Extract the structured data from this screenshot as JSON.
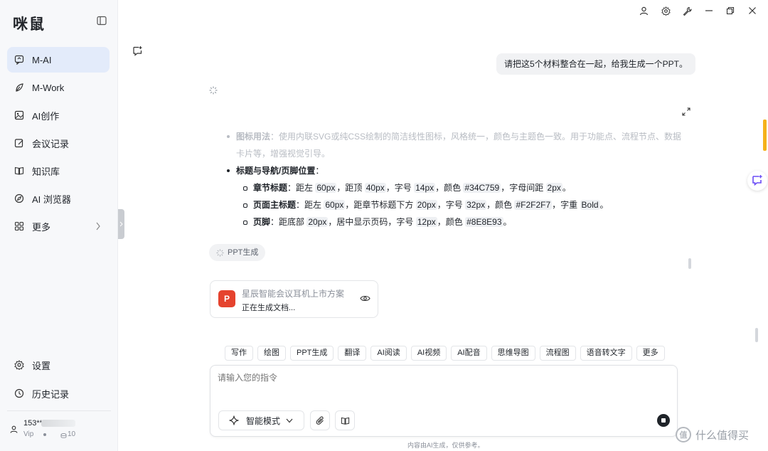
{
  "app": {
    "logo": "咪鼠"
  },
  "sidebar": {
    "items": [
      {
        "label": "M-AI",
        "icon": "chat-ai-icon",
        "active": true
      },
      {
        "label": "M-Work",
        "icon": "leaf-icon"
      },
      {
        "label": "AI创作",
        "icon": "image-icon"
      },
      {
        "label": "会议记录",
        "icon": "edit-note-icon"
      },
      {
        "label": "知识库",
        "icon": "book-icon"
      },
      {
        "label": "AI 浏览器",
        "icon": "compass-icon"
      },
      {
        "label": "更多",
        "icon": "grid-icon"
      }
    ],
    "settings_label": "设置",
    "history_label": "历史记录",
    "user": {
      "phone": "153**",
      "tier": "Vip",
      "points": "10"
    }
  },
  "chat": {
    "user_message": "请把这5个材料整合在一起，给我生成一个PPT。",
    "doc": {
      "faded_item_title": "图标用法",
      "faded_item_text": "：使用内联SVG或纯CSS绘制的简洁线性图标，风格统一，颜色与主题色一致。用于功能点、流程节点、数据卡片等，增强视觉引导。",
      "item_title": "标题与导航/页脚位置",
      "item_colon": "：",
      "sub1": {
        "title": "章节标题",
        "t1": "：距左 ",
        "v1": "60px",
        "t2": "，距顶 ",
        "v2": "40px",
        "t3": "，字号 ",
        "v3": "14px",
        "t4": "，颜色 ",
        "v4": "#34C759",
        "t5": "，字母间距 ",
        "v5": "2px",
        "t6": "。"
      },
      "sub2": {
        "title": "页面主标题",
        "t1": "：距左 ",
        "v1": "60px",
        "t2": "，距章节标题下方 ",
        "v2": "20px",
        "t3": "，字号 ",
        "v3": "32px",
        "t4": "，颜色 ",
        "v4": "#F2F2F7",
        "t5": "，字重 ",
        "v5": "Bold",
        "t6": "。"
      },
      "sub3": {
        "title": "页脚",
        "t1": "：距底部 ",
        "v1": "20px",
        "t2": "，居中显示页码，字号 ",
        "v2": "12px",
        "t3": "，颜色 ",
        "v3": "#8E8E93",
        "t4": "。"
      }
    },
    "ppt_chip_label": "PPT生成",
    "file_card": {
      "badge": "P",
      "title": "星辰智能会议耳机上市方案",
      "status": "正在生成文档..."
    }
  },
  "tools": [
    "写作",
    "绘图",
    "PPT生成",
    "翻译",
    "AI阅读",
    "AI视频",
    "AI配音",
    "思维导图",
    "流程图",
    "语音转文字",
    "更多"
  ],
  "composer": {
    "placeholder": "请输入您的指令",
    "mode_label": "智能模式"
  },
  "footer": {
    "disclaimer": "内容由AI生成，仅供参考。",
    "watermark": "什么值得买",
    "watermark_icon_text": "值"
  },
  "colors": {
    "accent": "#e3ebfa",
    "ppt_badge": "#e5432e",
    "scroll_accent": "#f5b21b"
  }
}
